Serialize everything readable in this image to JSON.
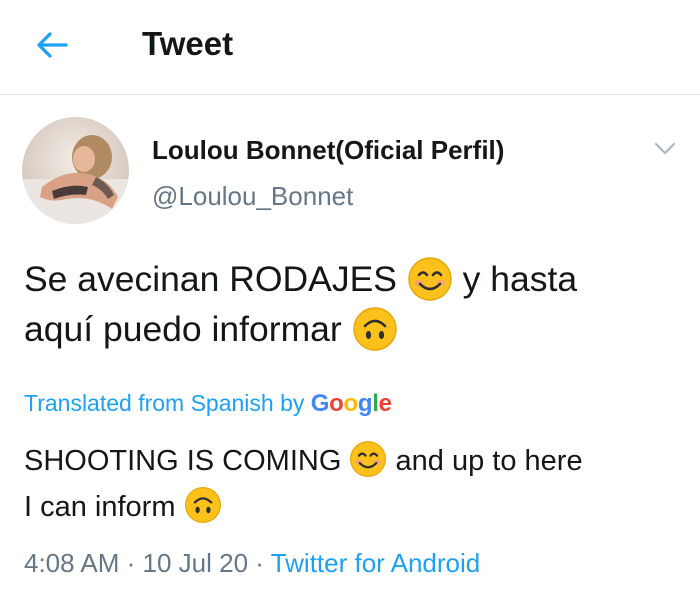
{
  "header": {
    "title": "Tweet",
    "back_icon": "arrow-left-icon"
  },
  "author": {
    "display_name": "Loulou Bonnet(Oficial Perfil)",
    "handle": "@Loulou_Bonnet"
  },
  "tweet": {
    "text_line1_a": "Se avecinan RODAJES ",
    "text_line1_b": " y hasta",
    "text_line2_a": "aquí puedo informar ",
    "emoji_1": "smiling-face-icon",
    "emoji_2": "upside-down-face-icon"
  },
  "translation": {
    "label_prefix": "Translated from Spanish by ",
    "google": [
      "G",
      "o",
      "o",
      "g",
      "l",
      "e"
    ],
    "line1_a": "SHOOTING IS COMING ",
    "line1_b": " and up to here",
    "line2_a": "I can inform "
  },
  "meta": {
    "time": "4:08 AM",
    "sep1": " · ",
    "date": "10 Jul 20",
    "sep2": " · ",
    "client": "Twitter for Android"
  },
  "colors": {
    "accent": "#1da1f2",
    "text": "#14171a",
    "secondary": "#657786",
    "divider": "#e1e8ed"
  }
}
